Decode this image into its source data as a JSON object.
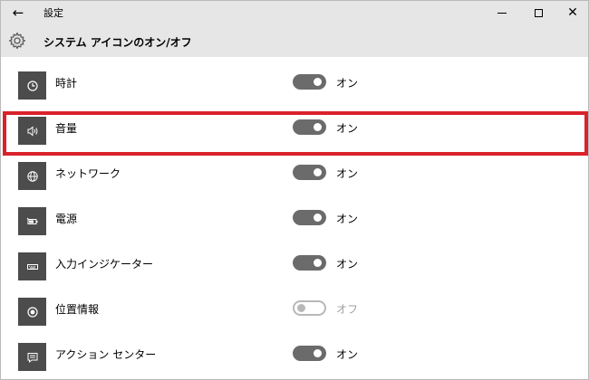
{
  "window": {
    "title": "設定",
    "back_icon": "back-arrow-icon",
    "min_icon": "minimize-icon",
    "max_icon": "maximize-icon",
    "close_icon": "close-icon"
  },
  "header": {
    "icon": "gear-icon",
    "title": "システム アイコンのオン/オフ"
  },
  "items": [
    {
      "label": "時計",
      "icon": "clock-icon",
      "state": "オン",
      "on": true
    },
    {
      "label": "音量",
      "icon": "volume-icon",
      "state": "オン",
      "on": true,
      "highlighted": true
    },
    {
      "label": "ネットワーク",
      "icon": "network-globe-icon",
      "state": "オン",
      "on": true
    },
    {
      "label": "電源",
      "icon": "battery-icon",
      "state": "オン",
      "on": true
    },
    {
      "label": "入力インジケーター",
      "icon": "keyboard-icon",
      "state": "オン",
      "on": true
    },
    {
      "label": "位置情報",
      "icon": "location-icon",
      "state": "オフ",
      "on": false
    },
    {
      "label": "アクション センター",
      "icon": "action-center-icon",
      "state": "オン",
      "on": true
    }
  ],
  "colors": {
    "titlebar_bg": "#e6e6e6",
    "icon_tile_bg": "#4c4c4c",
    "toggle_on": "#6b6b6b",
    "toggle_off_border": "#b8b8b8",
    "highlight": "#d9222a"
  }
}
